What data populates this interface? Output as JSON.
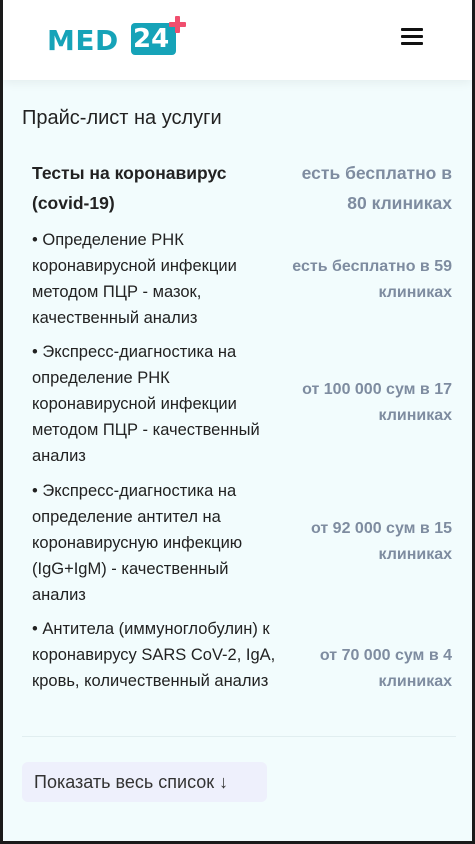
{
  "header": {
    "logo_text": "MED",
    "logo_number": "24",
    "menu_icon": "hamburger-menu-icon"
  },
  "price_list": {
    "title": "Прайс-лист на услуги",
    "category": {
      "name": "Тесты на коронавирус (covid-19)",
      "price": "есть бесплатно в 80 клиниках"
    },
    "items": [
      {
        "name": "• Определение РНК коронавирусной инфекции методом ПЦР - мазок, качественный анализ",
        "price": "есть бесплатно в 59 клиниках"
      },
      {
        "name": "• Экспресс-диагностика на определение РНК коронавирусной инфекции методом ПЦР - качественный анализ",
        "price": "от 100 000 сум в 17 клиниках"
      },
      {
        "name": "• Экспресс-диагностика на определение антител на коронавирусную инфекцию (IgG+IgM) - качественный анализ",
        "price": "от 92 000 сум в 15 клиниках"
      },
      {
        "name": "• Антитела (иммуноглобулин) к коронавирусу SARS CoV-2, IgA, кровь, количественный анализ",
        "price": "от 70 000 сум в 4 клиниках"
      }
    ],
    "show_all_label": "Показать весь список ↓"
  },
  "colors": {
    "brand": "#16a3b8",
    "plus": "#f04e6e",
    "price_text": "#7e8ca0",
    "page_bg": "#f2fcfd"
  }
}
